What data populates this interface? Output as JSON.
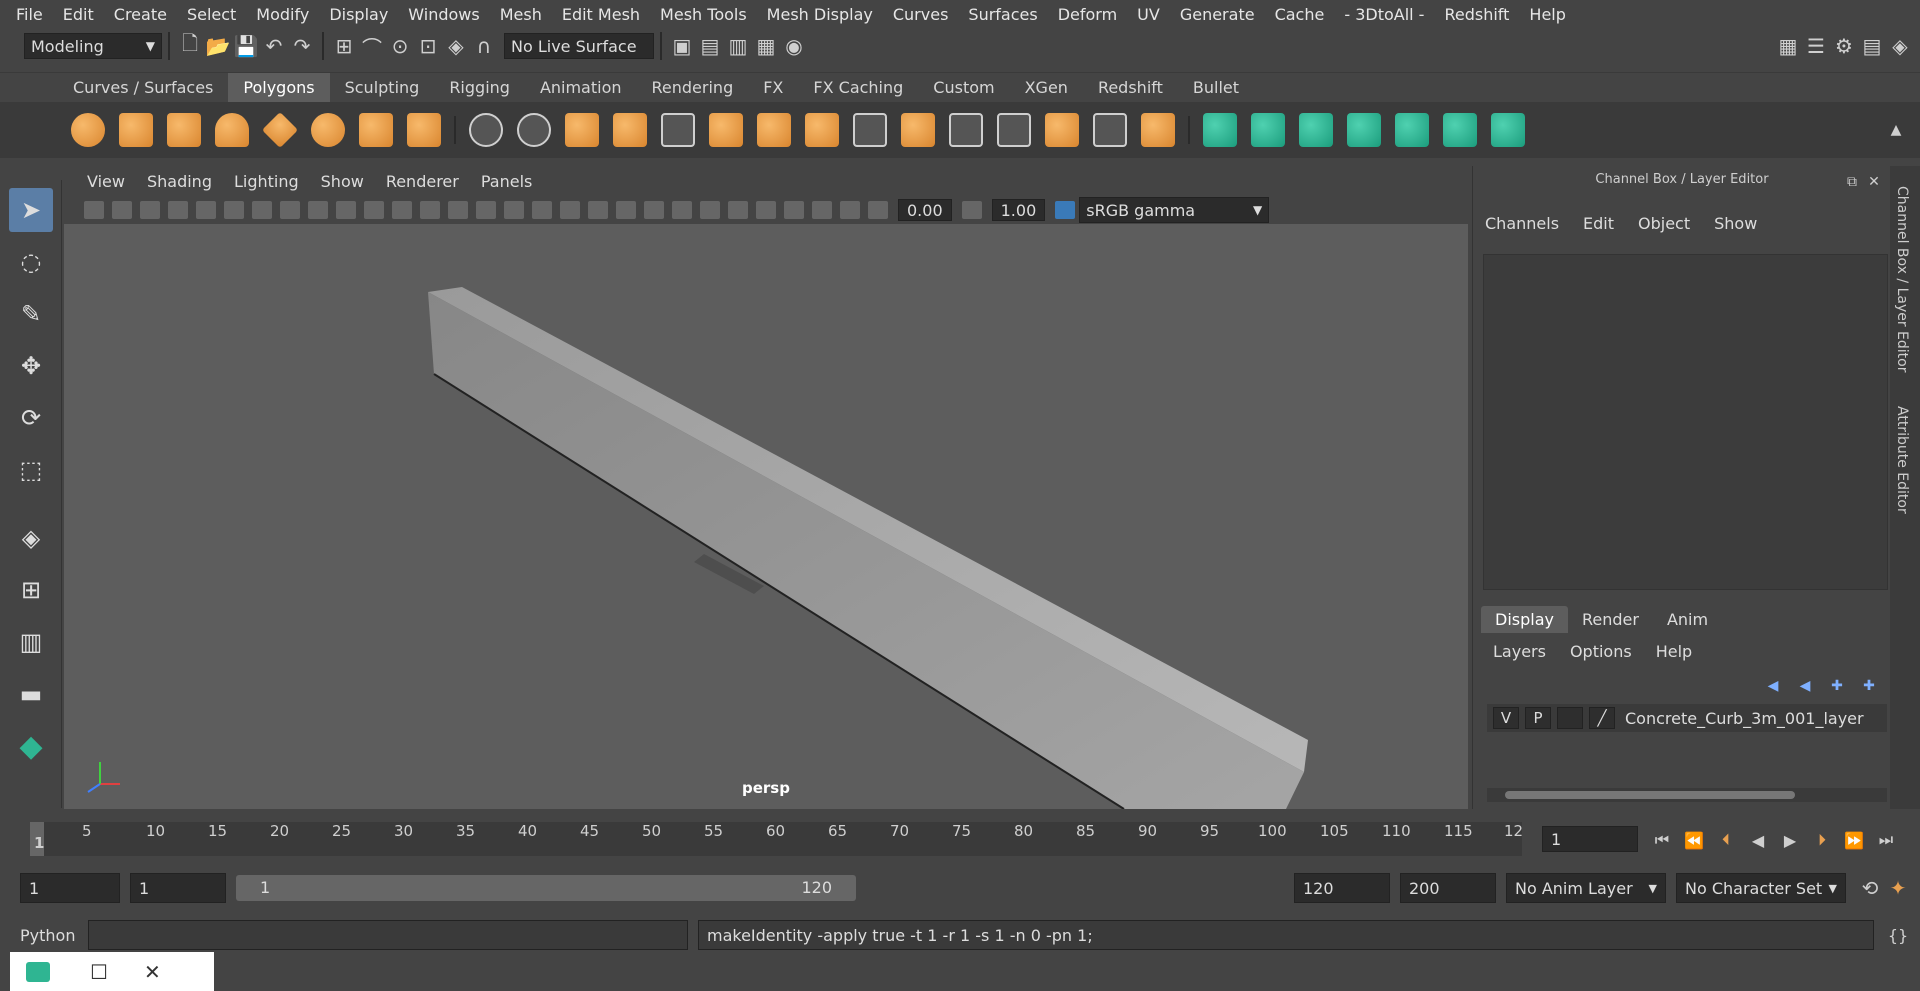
{
  "menubar": {
    "items": [
      "File",
      "Edit",
      "Create",
      "Select",
      "Modify",
      "Display",
      "Windows",
      "Mesh",
      "Edit Mesh",
      "Mesh Tools",
      "Mesh Display",
      "Curves",
      "Surfaces",
      "Deform",
      "UV",
      "Generate",
      "Cache",
      "- 3DtoAll -",
      "Redshift",
      "Help"
    ]
  },
  "statusline": {
    "mode": "Modeling",
    "live_surface": "No Live Surface"
  },
  "shelf": {
    "tabs": [
      "Curves / Surfaces",
      "Polygons",
      "Sculpting",
      "Rigging",
      "Animation",
      "Rendering",
      "FX",
      "FX Caching",
      "Custom",
      "XGen",
      "Redshift",
      "Bullet"
    ],
    "active_tab": "Polygons"
  },
  "panel": {
    "menu": [
      "View",
      "Shading",
      "Lighting",
      "Show",
      "Renderer",
      "Panels"
    ],
    "exposure": "0.00",
    "gamma": "1.00",
    "color_space": "sRGB gamma",
    "camera_label": "persp"
  },
  "channelbox": {
    "title": "Channel Box / Layer Editor",
    "menu": [
      "Channels",
      "Edit",
      "Object",
      "Show"
    ]
  },
  "layereditor": {
    "tabs": [
      "Display",
      "Render",
      "Anim"
    ],
    "active_tab": "Display",
    "menu": [
      "Layers",
      "Options",
      "Help"
    ],
    "layer": {
      "visibility": "V",
      "playback": "P",
      "name": "Concrete_Curb_3m_001_layer"
    }
  },
  "sidetabs": {
    "channel_box": "Channel Box / Layer Editor",
    "attribute_editor": "Attribute Editor"
  },
  "timeline": {
    "ticks": [
      "1",
      "5",
      "10",
      "15",
      "20",
      "25",
      "30",
      "35",
      "40",
      "45",
      "50",
      "55",
      "60",
      "65",
      "70",
      "75",
      "80",
      "85",
      "90",
      "95",
      "100",
      "105",
      "110",
      "115",
      "12"
    ],
    "current_frame": "1"
  },
  "range": {
    "start": "1",
    "playback_start": "1",
    "slider_start": "1",
    "slider_end": "120",
    "playback_end": "120",
    "end": "200",
    "anim_layer": "No Anim Layer",
    "character_set": "No Character Set"
  },
  "cmdline": {
    "language": "Python",
    "result": "makeIdentity -apply true -t 1 -r 1 -s 1 -n 0 -pn 1;"
  },
  "colors": {
    "accent": "#5b7ea6",
    "shelf_orange": "#e8a050",
    "shelf_green": "#2fb592"
  }
}
